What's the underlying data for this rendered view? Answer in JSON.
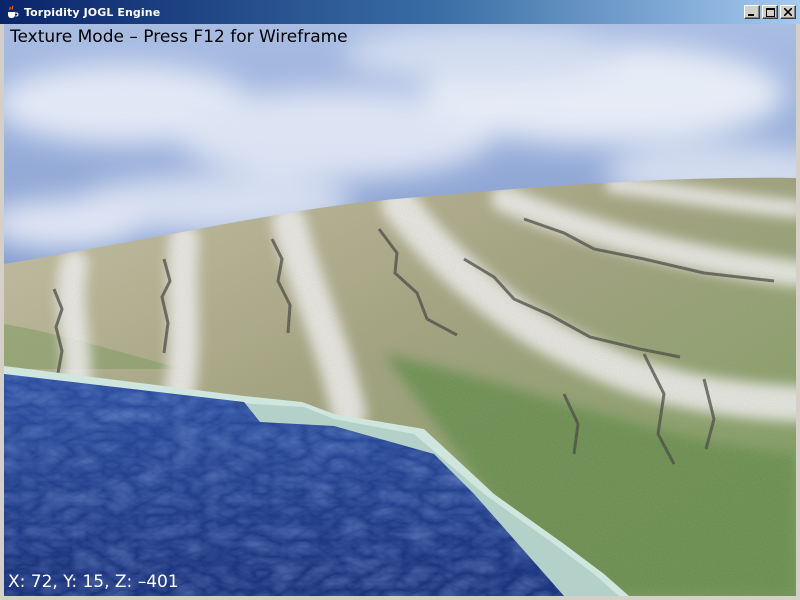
{
  "window": {
    "title": "Torpidity JOGL Engine",
    "icon": "java-cup-icon",
    "controls": {
      "minimize": "minimize-icon",
      "maximize": "maximize-icon",
      "close": "close-icon"
    }
  },
  "hud": {
    "mode_text": "Texture Mode – Press F12 for Wireframe",
    "coords_text": "X: 72, Y: 15, Z: –401"
  },
  "colors": {
    "titlebar_start": "#0a246a",
    "titlebar_end": "#a6caf0",
    "sky": "#8ea6d6",
    "water": "#1f3d8a",
    "grass": "#5f8a45"
  }
}
